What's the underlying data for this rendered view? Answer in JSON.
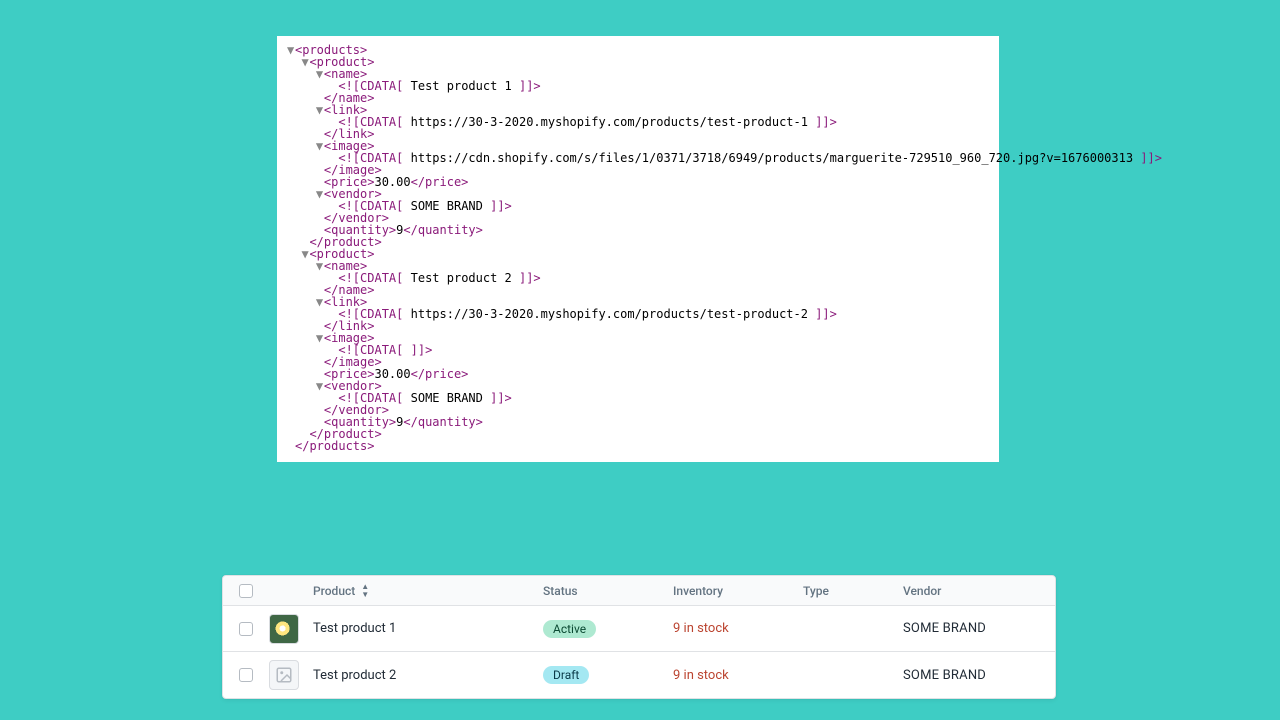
{
  "xml": {
    "lines": [
      {
        "indent": 0,
        "arrow": true,
        "kind": "open",
        "tag": "products"
      },
      {
        "indent": 1,
        "arrow": true,
        "kind": "open",
        "tag": "product"
      },
      {
        "indent": 2,
        "arrow": true,
        "kind": "open",
        "tag": "name"
      },
      {
        "indent": 3,
        "kind": "cdata",
        "value": " Test product 1 "
      },
      {
        "indent": 2,
        "kind": "close",
        "tag": "name"
      },
      {
        "indent": 2,
        "arrow": true,
        "kind": "open",
        "tag": "link"
      },
      {
        "indent": 3,
        "kind": "cdata",
        "value": " https://30-3-2020.myshopify.com/products/test-product-1 "
      },
      {
        "indent": 2,
        "kind": "close",
        "tag": "link"
      },
      {
        "indent": 2,
        "arrow": true,
        "kind": "open",
        "tag": "image"
      },
      {
        "indent": 3,
        "kind": "cdata",
        "value": " https://cdn.shopify.com/s/files/1/0371/3718/6949/products/marguerite-729510_960_720.jpg?v=1676000313 "
      },
      {
        "indent": 2,
        "kind": "close",
        "tag": "image"
      },
      {
        "indent": 2,
        "kind": "leaf",
        "tag": "price",
        "value": "30.00"
      },
      {
        "indent": 2,
        "arrow": true,
        "kind": "open",
        "tag": "vendor"
      },
      {
        "indent": 3,
        "kind": "cdata",
        "value": " SOME BRAND "
      },
      {
        "indent": 2,
        "kind": "close",
        "tag": "vendor"
      },
      {
        "indent": 2,
        "kind": "leaf",
        "tag": "quantity",
        "value": "9"
      },
      {
        "indent": 1,
        "kind": "close",
        "tag": "product"
      },
      {
        "indent": 1,
        "arrow": true,
        "kind": "open",
        "tag": "product"
      },
      {
        "indent": 2,
        "arrow": true,
        "kind": "open",
        "tag": "name"
      },
      {
        "indent": 3,
        "kind": "cdata",
        "value": " Test product 2 "
      },
      {
        "indent": 2,
        "kind": "close",
        "tag": "name"
      },
      {
        "indent": 2,
        "arrow": true,
        "kind": "open",
        "tag": "link"
      },
      {
        "indent": 3,
        "kind": "cdata",
        "value": " https://30-3-2020.myshopify.com/products/test-product-2 "
      },
      {
        "indent": 2,
        "kind": "close",
        "tag": "link"
      },
      {
        "indent": 2,
        "arrow": true,
        "kind": "open",
        "tag": "image"
      },
      {
        "indent": 3,
        "kind": "cdata",
        "value": " "
      },
      {
        "indent": 2,
        "kind": "close",
        "tag": "image"
      },
      {
        "indent": 2,
        "kind": "leaf",
        "tag": "price",
        "value": "30.00"
      },
      {
        "indent": 2,
        "arrow": true,
        "kind": "open",
        "tag": "vendor"
      },
      {
        "indent": 3,
        "kind": "cdata",
        "value": " SOME BRAND "
      },
      {
        "indent": 2,
        "kind": "close",
        "tag": "vendor"
      },
      {
        "indent": 2,
        "kind": "leaf",
        "tag": "quantity",
        "value": "9"
      },
      {
        "indent": 1,
        "kind": "close",
        "tag": "product"
      },
      {
        "indent": 0,
        "kind": "close",
        "tag": "products"
      }
    ]
  },
  "table": {
    "headers": {
      "product": "Product",
      "status": "Status",
      "inventory": "Inventory",
      "type": "Type",
      "vendor": "Vendor"
    },
    "rows": [
      {
        "name": "Test product 1",
        "status_label": "Active",
        "status_class": "active",
        "thumb": "flower",
        "inventory": "9 in stock",
        "type": "",
        "vendor": "SOME BRAND"
      },
      {
        "name": "Test product 2",
        "status_label": "Draft",
        "status_class": "draft",
        "thumb": "placeholder",
        "inventory": "9 in stock",
        "type": "",
        "vendor": "SOME BRAND"
      }
    ]
  }
}
